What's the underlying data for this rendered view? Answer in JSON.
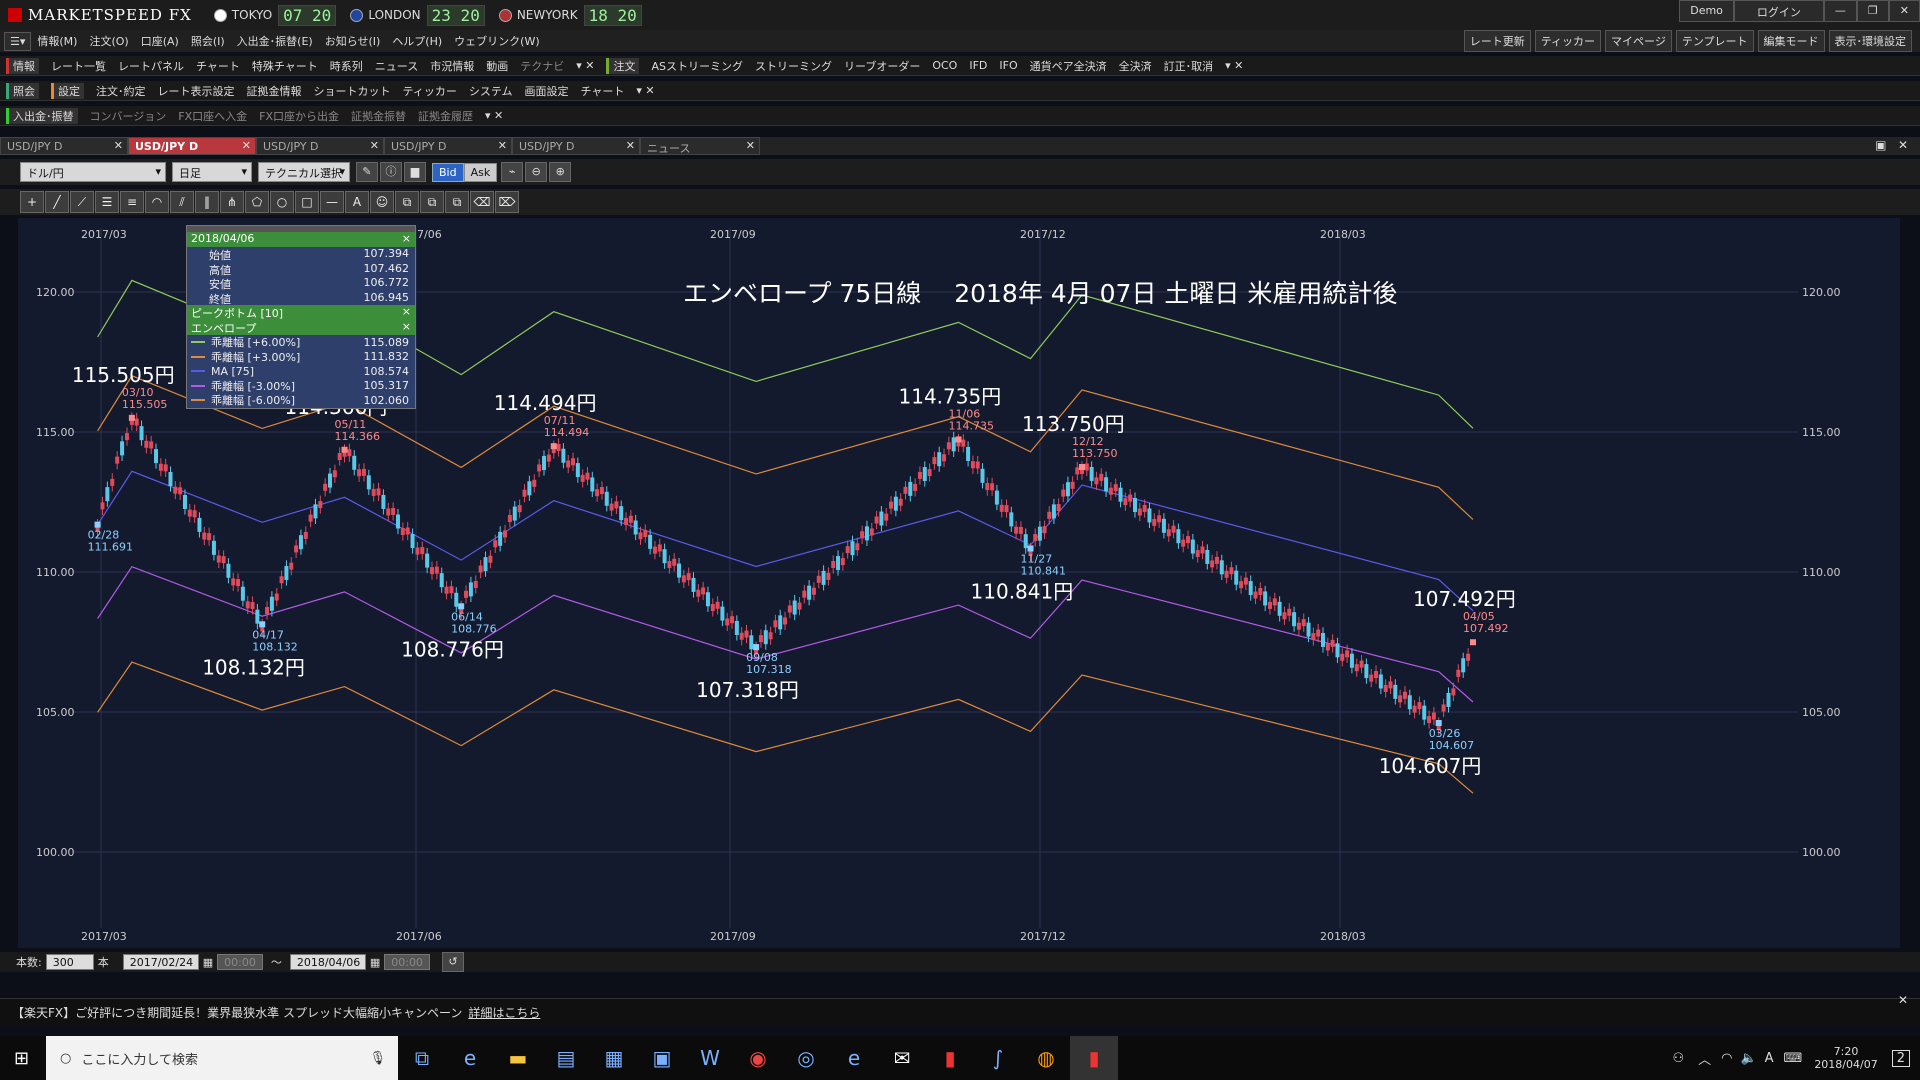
{
  "app": {
    "logo": "MARKETSPEED FX",
    "cities": [
      {
        "name": "TOKYO",
        "time": "07 20"
      },
      {
        "name": "LONDON",
        "time": "23 20"
      },
      {
        "name": "NEWYORK",
        "time": "18 20"
      }
    ],
    "demo": "Demo",
    "login": "ログイン"
  },
  "menu": [
    "情報(M)",
    "注文(O)",
    "口座(A)",
    "照会(I)",
    "入出金･振替(E)",
    "お知らせ(I)",
    "ヘルプ(H)",
    "ウェブリンク(W)"
  ],
  "menu_right": [
    "レート更新",
    "ティッカー",
    "マイページ",
    "テンプレート",
    "編集モード",
    "表示･環境設定"
  ],
  "toolbar1": {
    "sel": "情報",
    "items": [
      "レート一覧",
      "レートパネル",
      "チャート",
      "特殊チャート",
      "時系列",
      "ニュース",
      "市況情報",
      "動画",
      "テクナビ"
    ],
    "sel2": "注文",
    "items2": [
      "ASストリーミング",
      "ストリーミング",
      "リーブオーダー",
      "OCO",
      "IFD",
      "IFO",
      "通貨ペア全決済",
      "全決済",
      "訂正･取消"
    ]
  },
  "toolbar2": {
    "sel": "照会",
    "sel2": "設定",
    "items": [
      "注文･約定",
      "レート表示設定",
      "証拠金情報",
      "ショートカット",
      "ティッカー",
      "システム",
      "画面設定",
      "チャート"
    ]
  },
  "toolbar3": {
    "sel": "入出金･振替",
    "items": [
      "コンバージョン",
      "FX口座へ入金",
      "FX口座から出金",
      "証拠金振替",
      "証拠金履歴"
    ]
  },
  "tabs": [
    "USD/JPY D",
    "USD/JPY D",
    "USD/JPY D",
    "USD/JPY D",
    "USD/JPY D",
    "ニュース"
  ],
  "controls": {
    "pair": "ドル/円",
    "period": "日足",
    "tech": "テクニカル選択",
    "bid": "Bid",
    "ask": "Ask"
  },
  "info": {
    "date": "2018/04/06",
    "ohlc": [
      [
        "始値",
        "107.394"
      ],
      [
        "高値",
        "107.462"
      ],
      [
        "安値",
        "106.772"
      ],
      [
        "終値",
        "106.945"
      ]
    ],
    "peak": "ピークボトム [10]",
    "env": "エンベロープ",
    "lines": [
      {
        "name": "乖離幅 [+6.00%]",
        "value": "115.089",
        "color": "#8fcc5a"
      },
      {
        "name": "乖離幅 [+3.00%]",
        "value": "111.832",
        "color": "#e08a3a"
      },
      {
        "name": "MA [75]",
        "value": "108.574",
        "color": "#5a5ae8"
      },
      {
        "name": "乖離幅 [-3.00%]",
        "value": "105.317",
        "color": "#b35ae8"
      },
      {
        "name": "乖離幅 [-6.00%]",
        "value": "102.060",
        "color": "#e08a3a"
      }
    ]
  },
  "chart_data": {
    "type": "candlestick",
    "title": "エンベロープ 75日線　 2018年 4月 07日 土曜日 米雇用統計後",
    "x_ticks": [
      "2017/03",
      "2017/06",
      "2017/09",
      "2017/12",
      "2018/03"
    ],
    "y_ticks": [
      "120.00",
      "115.00",
      "110.00",
      "105.00",
      "100.00"
    ],
    "ylim": [
      100,
      121
    ],
    "peaks": [
      {
        "date": "03/10",
        "value": "115.505",
        "label": "115.505円",
        "type": "high"
      },
      {
        "date": "05/11",
        "value": "114.366",
        "label": "114.366円",
        "type": "high"
      },
      {
        "date": "07/11",
        "value": "114.494",
        "label": "114.494円",
        "type": "high"
      },
      {
        "date": "11/06",
        "value": "114.735",
        "label": "114.735円",
        "type": "high"
      },
      {
        "date": "12/12",
        "value": "113.750",
        "label": "113.750円",
        "type": "high"
      },
      {
        "date": "04/05",
        "value": "107.492",
        "label": "107.492円",
        "type": "high"
      },
      {
        "date": "02/28",
        "value": "111.691",
        "label": "",
        "type": "low"
      },
      {
        "date": "04/17",
        "value": "108.132",
        "label": "108.132円",
        "type": "low"
      },
      {
        "date": "06/14",
        "value": "108.776",
        "label": "108.776円",
        "type": "low"
      },
      {
        "date": "09/08",
        "value": "107.318",
        "label": "107.318円",
        "type": "low"
      },
      {
        "date": "11/27",
        "value": "110.841",
        "label": "110.841円",
        "type": "low"
      },
      {
        "date": "03/26",
        "value": "104.607",
        "label": "104.607円",
        "type": "low"
      }
    ]
  },
  "bottom": {
    "count_label": "本数:",
    "count": "300",
    "unit": "本",
    "from": "2017/02/24",
    "time1": "00:00",
    "tilde": "～",
    "to": "2018/04/06",
    "time2": "00:00"
  },
  "campaign": {
    "text": "【楽天FX】ご好評につき期間延長！業界最狭水準 スプレッド大幅縮小キャンペーン",
    "link": "詳細はこちら"
  },
  "taskbar": {
    "search": "ここに入力して検索",
    "time": "7:20",
    "date": "2018/04/07",
    "ime": "A"
  }
}
